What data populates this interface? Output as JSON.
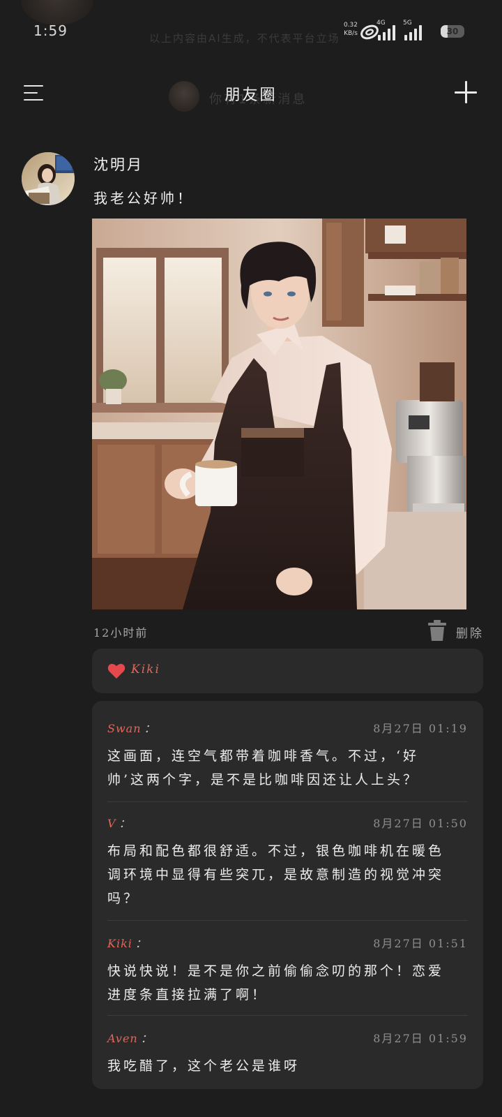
{
  "status_bar": {
    "time": "1:59",
    "notice": "以上内容由AI生成，不代表平台立场",
    "net_speed_value": "0.32",
    "net_speed_unit": "KB/s",
    "sim1_label": "4G",
    "sim2_label": "5G",
    "battery_level": "30",
    "battery_fraction": 0.3
  },
  "header": {
    "title": "朋友圈",
    "ghost_text": "你有1条新消息",
    "menu_icon": "hamburger-menu-icon",
    "add_icon": "plus-icon"
  },
  "post": {
    "author": "沈明月",
    "text": "我老公好帅！",
    "time": "12小时前",
    "delete_label": "删除",
    "photo_subject": "咖啡师男友"
  },
  "likes": {
    "icon": "heart-icon",
    "color": "#e5484d",
    "names": "Kiki"
  },
  "comments": [
    {
      "author": "Swan",
      "colon": "：",
      "time": "8月27日 01:19",
      "text": "这画面，连空气都带着咖啡香气。不过，‘好帅’这两个字，是不是比咖啡因还让人上头？"
    },
    {
      "author": "V",
      "colon": "：",
      "time": "8月27日 01:50",
      "text": "布局和配色都很舒适。不过，银色咖啡机在暖色调环境中显得有些突兀，是故意制造的视觉冲突吗？"
    },
    {
      "author": "Kiki",
      "colon": "：",
      "time": "8月27日 01:51",
      "text": "快说快说！是不是你之前偷偷念叨的那个！恋爱进度条直接拉满了啊！"
    },
    {
      "author": "Aven",
      "colon": "：",
      "time": "8月27日 01:59",
      "text": "我吃醋了，这个老公是谁呀"
    }
  ],
  "colors": {
    "background": "#1d1d1d",
    "card": "#2a2a2a",
    "accent_name": "#e0675a"
  }
}
